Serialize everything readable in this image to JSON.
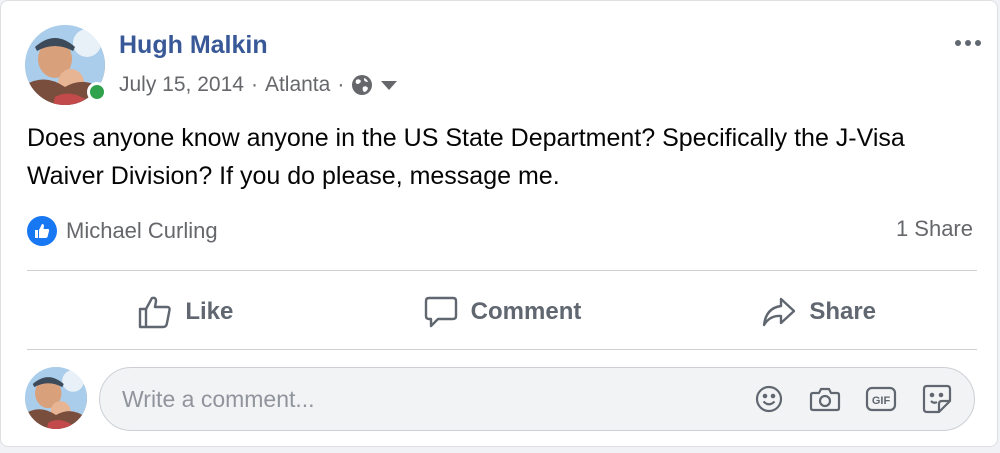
{
  "post": {
    "author": "Hugh Malkin",
    "date": "July 15, 2014",
    "location": "Atlanta",
    "separator": "·",
    "privacy_icon": "globe-icon",
    "text": "Does anyone know anyone in the US State Department? Specifically the J-Visa Waiver Division? If you do please, message me.",
    "liked_by": "Michael Curling",
    "share_count": "1 Share"
  },
  "actions": {
    "like_label": "Like",
    "comment_label": "Comment",
    "share_label": "Share"
  },
  "comment": {
    "placeholder": "Write a comment...",
    "icons": [
      "emoji-icon",
      "camera-icon",
      "gif-icon",
      "sticker-icon"
    ]
  },
  "colors": {
    "author": "#385898",
    "like_badge": "#1877f2",
    "online": "#31a24c",
    "secondary_text": "#65676b"
  }
}
